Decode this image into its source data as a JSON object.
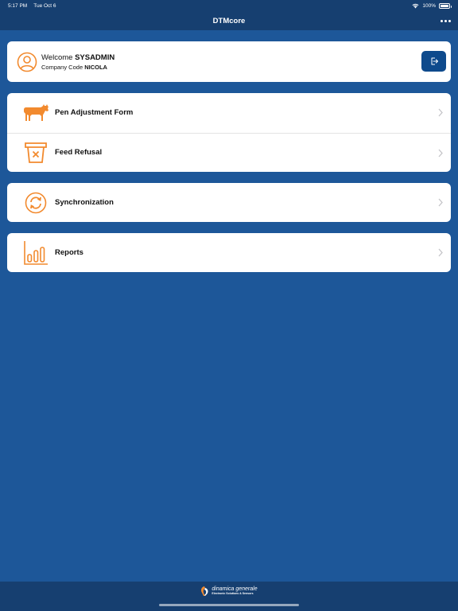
{
  "status_bar": {
    "time": "5:17 PM",
    "date": "Tue Oct 6",
    "battery": "100%",
    "battery_level": 1.0
  },
  "nav": {
    "title": "DTMcore"
  },
  "user_card": {
    "welcome_prefix": "Welcome",
    "username": "SYSADMIN",
    "company_prefix": "Company Code",
    "company_code": "NICOLA"
  },
  "menu": {
    "pen_adjustment": "Pen Adjustment Form",
    "feed_refusal": "Feed Refusal",
    "synchronization": "Synchronization",
    "reports": "Reports"
  },
  "footer": {
    "brand_name": "dinamica generale",
    "tagline": "Electronic Solutions & Sensors"
  },
  "colors": {
    "background": "#1d5799",
    "bar": "#163f70",
    "accent": "#f28a2e",
    "button": "#0e4a8c"
  }
}
